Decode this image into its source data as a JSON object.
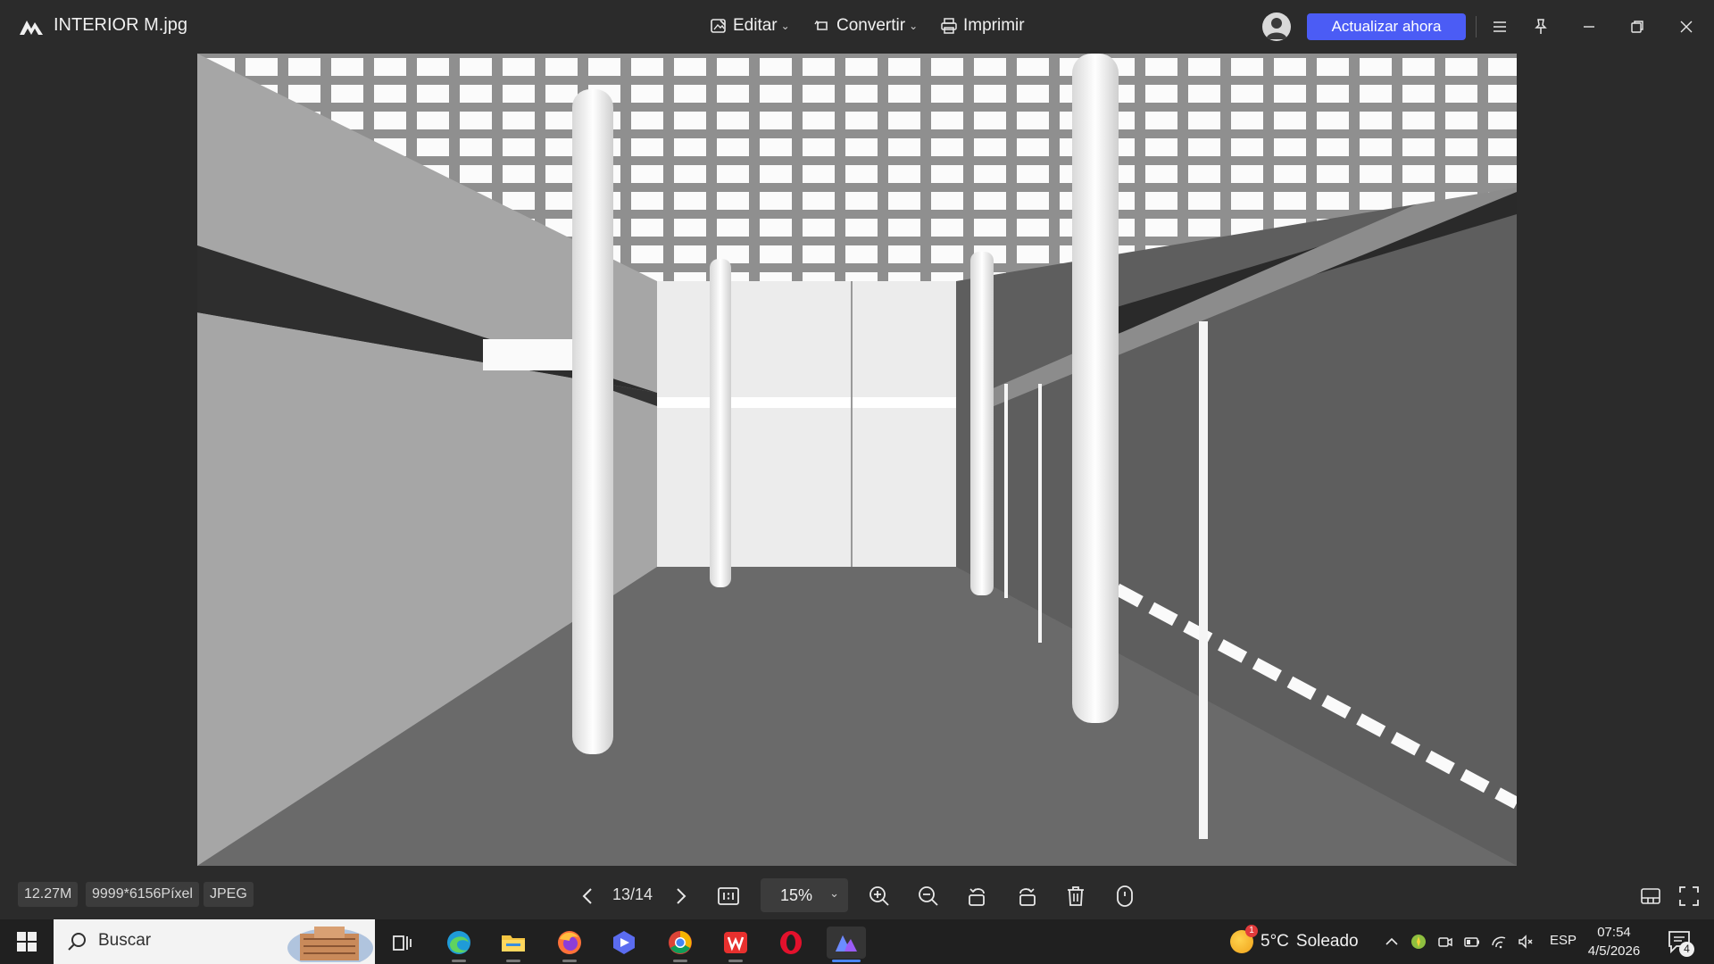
{
  "window": {
    "title": "INTERIOR M.jpg",
    "menus": [
      {
        "label": "Editar",
        "icon": "edit-image-icon",
        "has_dropdown": true
      },
      {
        "label": "Convertir",
        "icon": "convert-icon",
        "has_dropdown": true
      },
      {
        "label": "Imprimir",
        "icon": "printer-icon",
        "has_dropdown": false
      }
    ],
    "upgrade_label": "Actualizar ahora",
    "accent_color": "#4b5cf5",
    "controls": [
      "hamburger-menu-icon",
      "pin-icon",
      "minimize-icon",
      "restore-icon",
      "close-icon"
    ]
  },
  "image": {
    "description_icon": "architectural-interior-render",
    "page_current": "13/14"
  },
  "info": {
    "file_size": "12.27M",
    "dimensions": "9999*6156Píxel",
    "format": "JPEG"
  },
  "toolbar": {
    "page_label": "13/14",
    "zoom": "15%",
    "tools": [
      "prev-icon",
      "next-icon",
      "actual-size-icon",
      "zoom-in-icon",
      "zoom-out-icon",
      "rotate-left-icon",
      "rotate-right-icon",
      "delete-icon",
      "info-icon"
    ],
    "right_tools": [
      "thumbnail-strip-icon",
      "fullscreen-icon"
    ]
  },
  "taskbar": {
    "search_placeholder": "Buscar",
    "apps": [
      "task-view-icon",
      "edge-icon",
      "file-explorer-icon",
      "firefox-icon",
      "clipchamp-icon",
      "chrome-icon",
      "wps-icon",
      "opera-icon",
      "photo-viewer-icon"
    ],
    "weather": {
      "temp": "5°C",
      "condition": "Soleado",
      "alert_count": "1"
    },
    "language": "ESP",
    "time": "07:54",
    "date": "4/5/2026",
    "notifications": "4"
  }
}
